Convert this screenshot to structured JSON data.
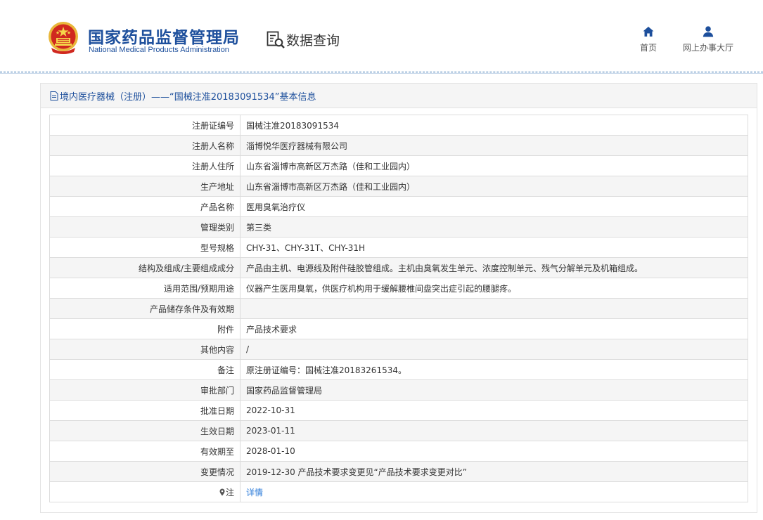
{
  "header": {
    "logo_cn": "国家药品监督管理局",
    "logo_en": "National Medical Products Administration",
    "query_label": "数据查询",
    "nav": [
      {
        "label": "首页",
        "icon": "home-icon"
      },
      {
        "label": "网上办事大厅",
        "icon": "user-icon"
      }
    ]
  },
  "panel": {
    "title": "境内医疗器械（注册）——“国械注准20183091534”基本信息",
    "icon": "document-icon"
  },
  "rows": [
    {
      "label": "注册证编号",
      "value": "国械注准20183091534"
    },
    {
      "label": "注册人名称",
      "value": "淄博悦华医疗器械有限公司"
    },
    {
      "label": "注册人住所",
      "value": "山东省淄博市高新区万杰路（佳和工业园内）"
    },
    {
      "label": "生产地址",
      "value": "山东省淄博市高新区万杰路（佳和工业园内）"
    },
    {
      "label": "产品名称",
      "value": "医用臭氧治疗仪"
    },
    {
      "label": "管理类别",
      "value": "第三类"
    },
    {
      "label": "型号规格",
      "value": "CHY-31、CHY-31T、CHY-31H"
    },
    {
      "label": "结构及组成/主要组成成分",
      "value": "产品由主机、电源线及附件硅胶管组成。主机由臭氧发生单元、浓度控制单元、残气分解单元及机箱组成。"
    },
    {
      "label": "适用范围/预期用途",
      "value": "仪器产生医用臭氧，供医疗机构用于缓解腰椎间盘突出症引起的腰腿疼。"
    },
    {
      "label": "产品储存条件及有效期",
      "value": ""
    },
    {
      "label": "附件",
      "value": "产品技术要求"
    },
    {
      "label": "其他内容",
      "value": "/"
    },
    {
      "label": "备注",
      "value": "原注册证编号：国械注准20183261534。"
    },
    {
      "label": "审批部门",
      "value": "国家药品监督管理局"
    },
    {
      "label": "批准日期",
      "value": "2022-10-31"
    },
    {
      "label": "生效日期",
      "value": "2023-01-11"
    },
    {
      "label": "有效期至",
      "value": "2028-01-10"
    },
    {
      "label": "变更情况",
      "value": "2019-12-30 产品技术要求变更见“产品技术要求变更对比”"
    }
  ],
  "note_row": {
    "label": "注",
    "link": "详情",
    "icon": "location-pin-icon"
  },
  "colors": {
    "brand_blue": "#1d4f9c",
    "link_blue": "#2b7bd9",
    "emblem_red": "#d0281f",
    "emblem_gold": "#f2c230"
  }
}
